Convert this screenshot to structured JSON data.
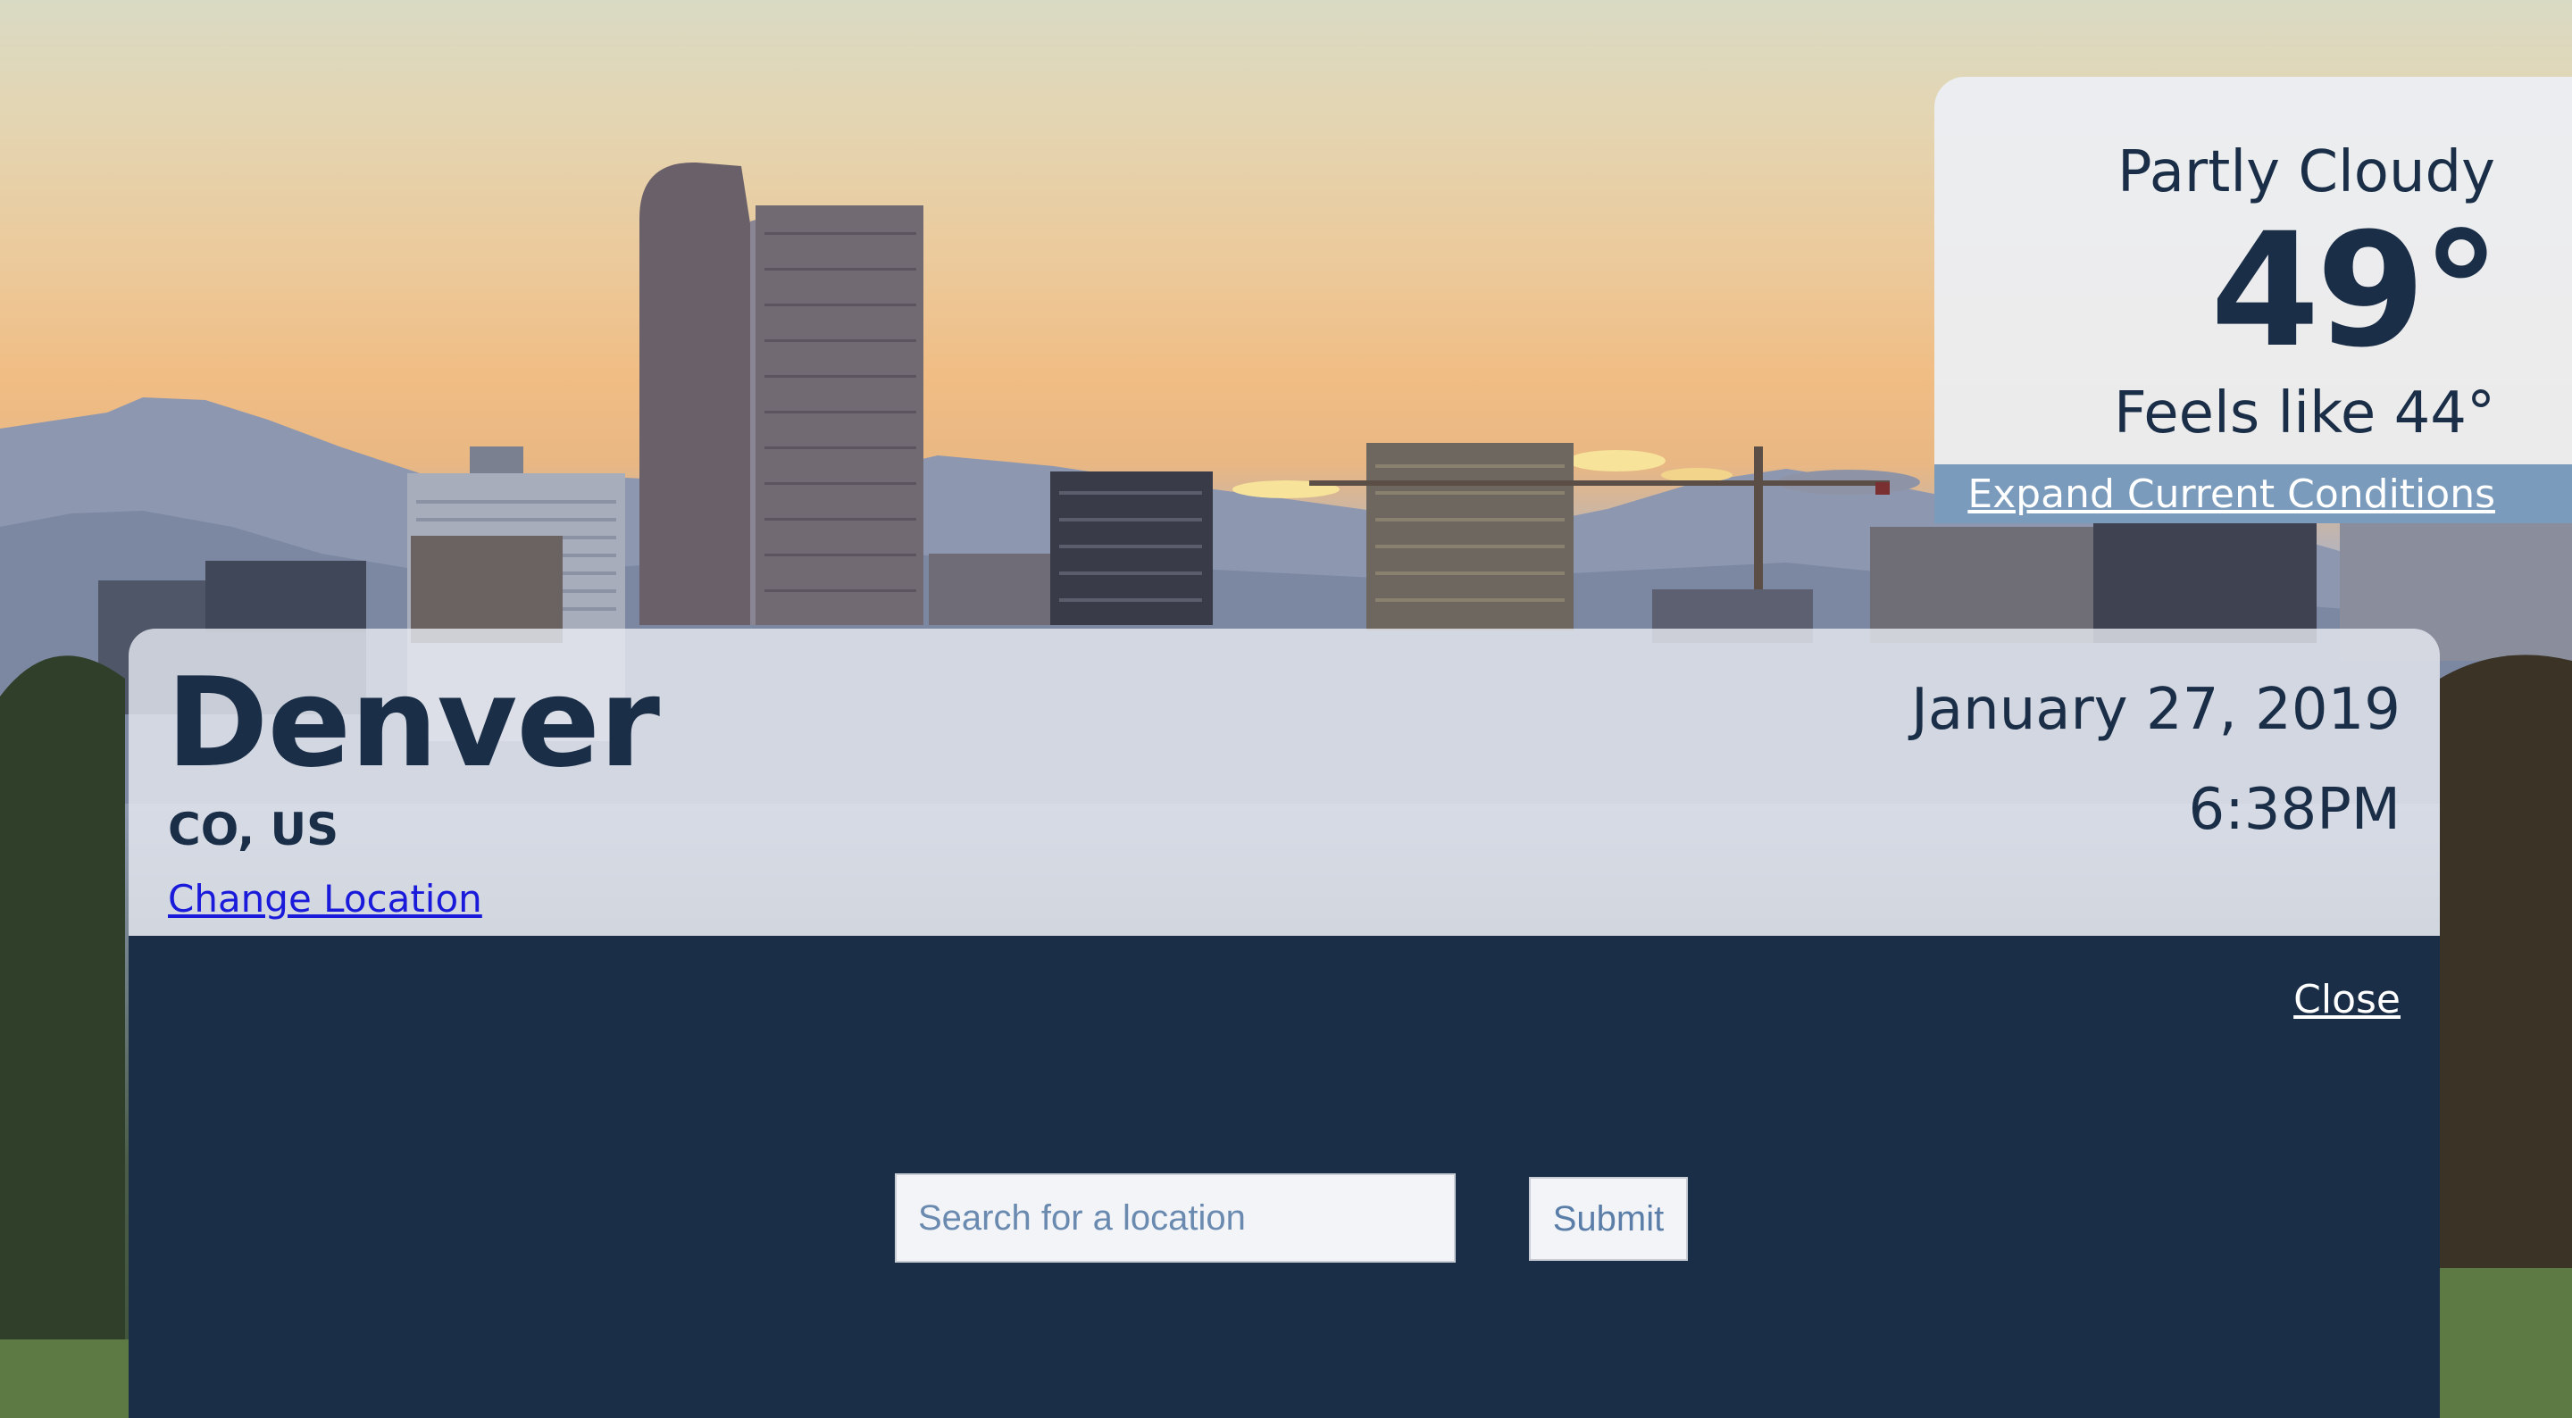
{
  "current_conditions": {
    "summary": "Partly Cloudy",
    "temperature": "49°",
    "feels_like": "Feels like 44°",
    "expand_label": "Expand Current Conditions"
  },
  "location": {
    "city": "Denver",
    "region": "CO, US",
    "change_label": "Change Location",
    "date": "January 27, 2019",
    "time": "6:38PM"
  },
  "search": {
    "close_label": "Close",
    "placeholder": "Search for a location",
    "submit_label": "Submit"
  },
  "colors": {
    "navy": "#1a2e47",
    "expand_bar": "#6e92b6",
    "link_blue": "#1a1adb"
  }
}
